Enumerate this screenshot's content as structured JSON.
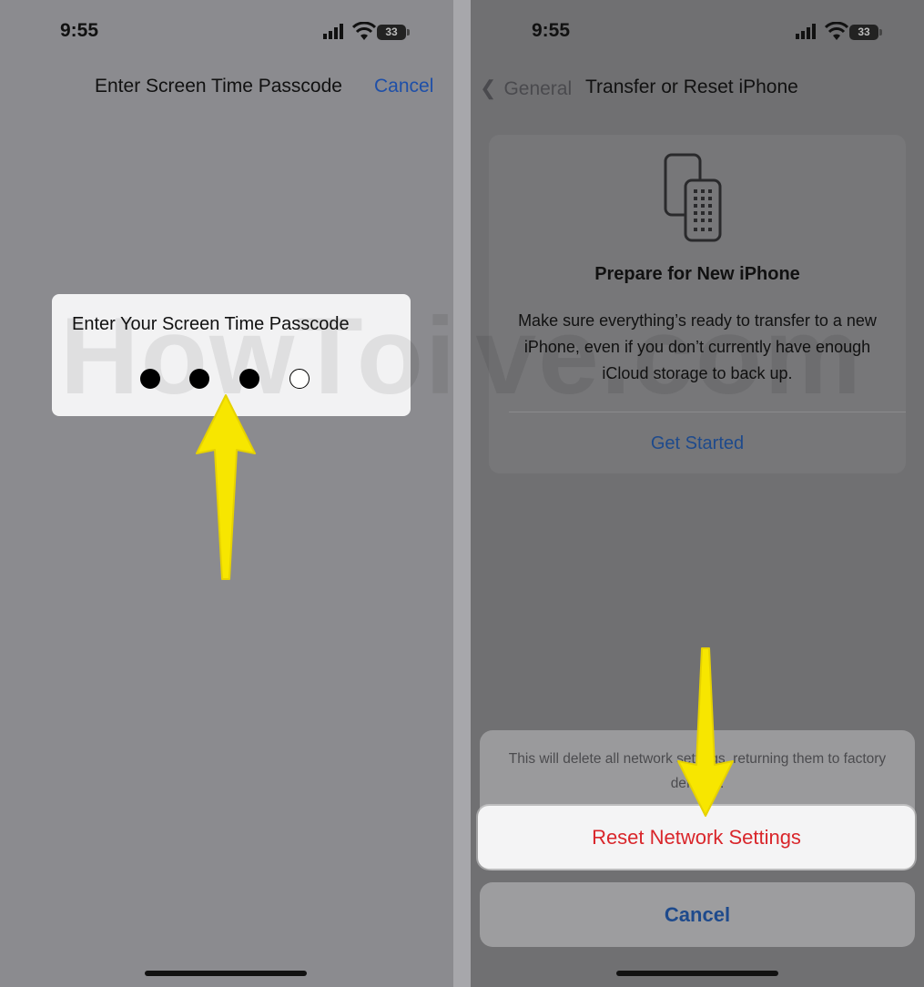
{
  "left_screen": {
    "status": {
      "time": "9:55",
      "battery": "33"
    },
    "nav": {
      "title": "Enter Screen Time Passcode",
      "cancel_label": "Cancel"
    },
    "passcode": {
      "prompt": "Enter Your Screen Time Passcode",
      "digits_total": 4,
      "digits_entered": 3
    },
    "watermark": "HowToiSo"
  },
  "right_screen": {
    "status": {
      "time": "9:55",
      "battery": "33"
    },
    "nav": {
      "back_label": "General",
      "title": "Transfer or Reset iPhone"
    },
    "card": {
      "icon": "transfer-phones-icon",
      "title": "Prepare for New iPhone",
      "description": "Make sure everything’s ready to transfer to a new iPhone, even if you don’t currently have enough iCloud storage to back up.",
      "action_label": "Get Started"
    },
    "watermark": "lve.com",
    "action_sheet": {
      "message": "This will delete all network settings, returning them to factory defaults.",
      "destructive_label": "Reset Network Settings",
      "cancel_label": "Cancel"
    }
  },
  "annotations": {
    "arrow_color": "#f7e600"
  },
  "colors": {
    "link_blue": "#1e4fa8",
    "destructive_red": "#d9262b"
  }
}
